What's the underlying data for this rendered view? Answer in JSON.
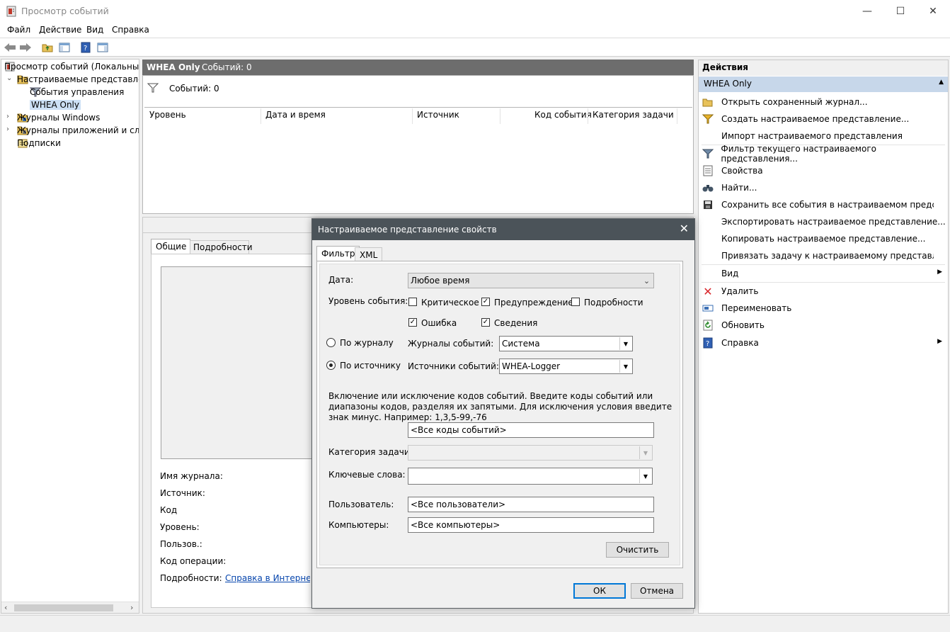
{
  "window": {
    "title": "Просмотр событий",
    "controls": {
      "minimize": "—",
      "maximize": "☐",
      "close": "✕"
    }
  },
  "menu": [
    "Файл",
    "Действие",
    "Вид",
    "Справка"
  ],
  "toolbar": {
    "icons": [
      "back-arrow-icon",
      "forward-arrow-icon",
      "folder-up-icon",
      "show-hide-tree-icon",
      "help-icon",
      "show-hide-action-pane-icon"
    ]
  },
  "tree": {
    "root": "Просмотр событий (Локальный)",
    "custom_views": "Настраиваемые представления",
    "admin_events": "События управления",
    "whea_only": "WHEA Only",
    "windows_logs": "Журналы Windows",
    "app_logs": "Журналы приложений и служб",
    "subscriptions": "Подписки"
  },
  "center": {
    "header_title": "WHEA Only",
    "header_count": "Событий: 0",
    "filter_count": "Событий: 0",
    "columns": [
      "Уровень",
      "Дата и время",
      "Источник",
      "Код события",
      "Категория задачи"
    ],
    "detail_tabs": [
      "Общие",
      "Подробности"
    ],
    "detail_labels": [
      "Имя журнала:",
      "Источник:",
      "Код",
      "Уровень:",
      "Пользов.:",
      "Код операции:",
      "Подробности:"
    ],
    "detail_link": "Справка в Интернете журнала событий"
  },
  "actions": {
    "header": "Действия",
    "subheader": "WHEA Only",
    "items": [
      {
        "label": "Открыть сохраненный журнал...",
        "icon": "open-folder-icon"
      },
      {
        "label": "Создать настраиваемое представление...",
        "icon": "filter-create-icon"
      },
      {
        "label": "Импорт настраиваемого представления",
        "icon": ""
      },
      {
        "label": "Фильтр текущего настраиваемого представления...",
        "icon": "filter-icon"
      },
      {
        "label": "Свойства",
        "icon": "properties-icon"
      },
      {
        "label": "Найти...",
        "icon": "binoculars-icon"
      },
      {
        "label": "Сохранить все события в настраиваемом представлении как...",
        "icon": "save-icon"
      },
      {
        "label": "Экспортировать настраиваемое представление...",
        "icon": ""
      },
      {
        "label": "Копировать настраиваемое представление...",
        "icon": ""
      },
      {
        "label": "Привязать задачу к настраиваемому представлению...",
        "icon": ""
      },
      {
        "label": "Вид",
        "icon": ""
      },
      {
        "label": "Удалить",
        "icon": "delete-icon"
      },
      {
        "label": "Переименовать",
        "icon": "rename-icon"
      },
      {
        "label": "Обновить",
        "icon": "refresh-icon"
      },
      {
        "label": "Справка",
        "icon": "help-icon"
      }
    ]
  },
  "dialog": {
    "title": "Настраиваемое представление свойств",
    "tabs": [
      "Фильтр",
      "XML"
    ],
    "date_label": "Дата:",
    "date_value": "Любое время",
    "level_label": "Уровень события:",
    "levels": {
      "critical": {
        "label": "Критическое",
        "checked": false
      },
      "warning": {
        "label": "Предупреждение",
        "checked": true
      },
      "verbose": {
        "label": "Подробности",
        "checked": false
      },
      "error": {
        "label": "Ошибка",
        "checked": true
      },
      "info": {
        "label": "Сведения",
        "checked": true
      }
    },
    "by_log_label": "По журналу",
    "by_source_label": "По источнику",
    "selected_mode": "by_source",
    "event_logs_label": "Журналы событий:",
    "event_logs_value": "Система",
    "event_sources_label": "Источники событий:",
    "event_sources_value": "WHEA-Logger",
    "description": "Включение или исключение кодов событий. Введите коды событий или диапазоны кодов, разделяя их запятыми. Для исключения условия введите знак минус. Например: 1,3,5-99,-76",
    "event_ids_value": "<Все коды событий>",
    "task_category_label": "Категория задачи:",
    "task_category_value": "",
    "keywords_label": "Ключевые слова:",
    "keywords_value": "",
    "user_label": "Пользователь:",
    "user_value": "<Все пользователи>",
    "computers_label": "Компьютеры:",
    "computers_value": "<Все компьютеры>",
    "clear_button": "Очистить",
    "ok_button": "ОК",
    "cancel_button": "Отмена"
  }
}
